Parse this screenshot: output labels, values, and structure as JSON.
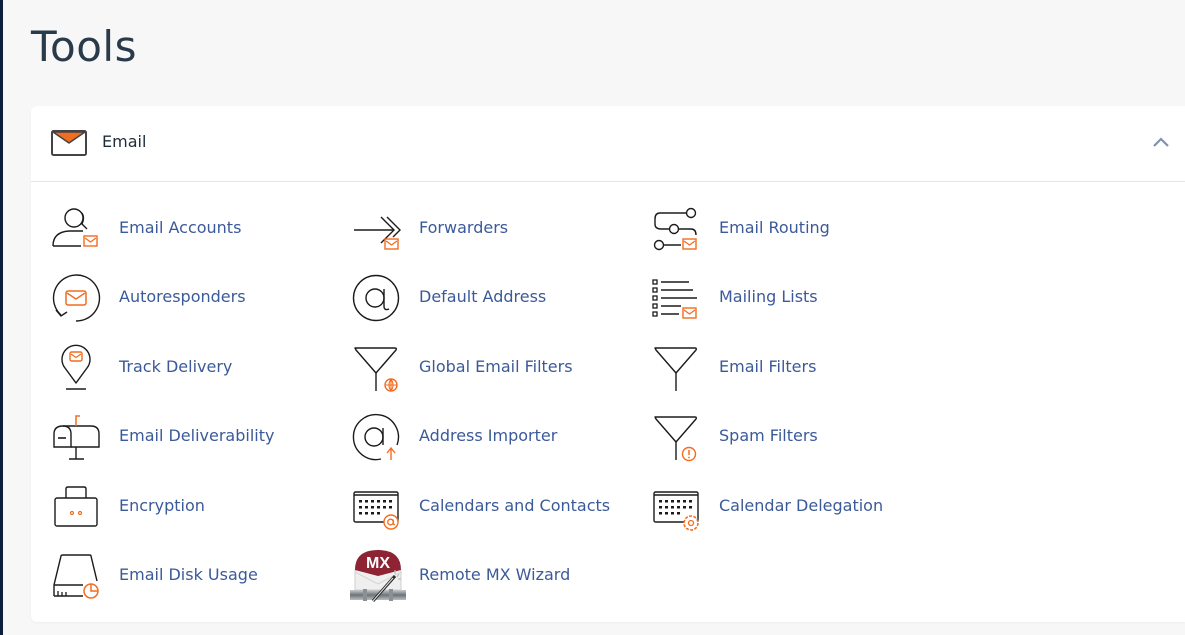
{
  "page": {
    "title": "Tools"
  },
  "colors": {
    "accent": "#f26d21",
    "link": "#3b5a99",
    "icon_stroke": "#1b1b1b",
    "sidebar": "#0c1f3f"
  },
  "section": {
    "title": "Email",
    "icon": "envelope-icon",
    "collapse_icon": "chevron-up-icon",
    "items": [
      {
        "label": "Email Accounts",
        "icon": "user-mail-icon"
      },
      {
        "label": "Forwarders",
        "icon": "forward-arrow-icon"
      },
      {
        "label": "Email Routing",
        "icon": "routing-icon"
      },
      {
        "label": "Autoresponders",
        "icon": "autoresponder-icon"
      },
      {
        "label": "Default Address",
        "icon": "at-sign-icon"
      },
      {
        "label": "Mailing Lists",
        "icon": "mailing-list-icon"
      },
      {
        "label": "Track Delivery",
        "icon": "map-pin-mail-icon"
      },
      {
        "label": "Global Email Filters",
        "icon": "funnel-globe-icon"
      },
      {
        "label": "Email Filters",
        "icon": "funnel-icon"
      },
      {
        "label": "Email Deliverability",
        "icon": "mailbox-icon"
      },
      {
        "label": "Address Importer",
        "icon": "at-import-icon"
      },
      {
        "label": "Spam Filters",
        "icon": "funnel-warning-icon"
      },
      {
        "label": "Encryption",
        "icon": "lock-icon"
      },
      {
        "label": "Calendars and Contacts",
        "icon": "calendar-at-icon"
      },
      {
        "label": "Calendar Delegation",
        "icon": "calendar-gear-icon"
      },
      {
        "label": "Email Disk Usage",
        "icon": "disk-usage-icon"
      },
      {
        "label": "Remote MX Wizard",
        "icon": "mx-wizard-icon"
      }
    ]
  }
}
